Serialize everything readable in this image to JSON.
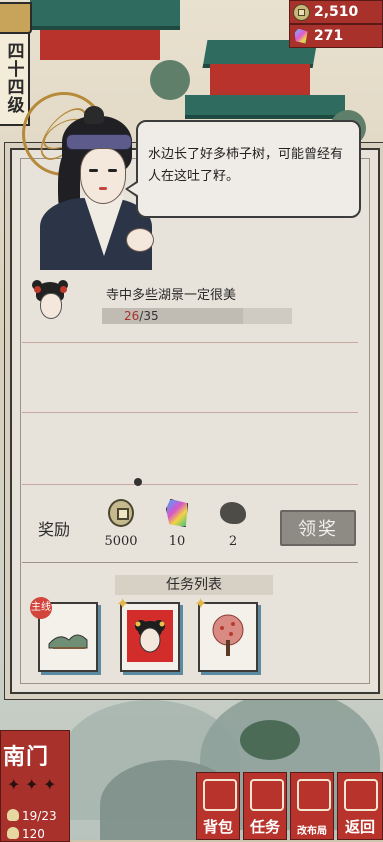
{
  "level": {
    "label": "四十四级"
  },
  "currencies": [
    {
      "icon": "coin-icon",
      "value": "2,510"
    },
    {
      "icon": "gem-icon",
      "value": "271"
    }
  ],
  "dialog": {
    "text": "水边长了好多柿子树，可能曾经有人在这吐了籽。"
  },
  "tasks": [
    {
      "title": "寺中多些湖景一定很美",
      "progress_current": "26",
      "progress_sep_total": "/35",
      "progress_fraction": 0.743
    }
  ],
  "rewards": {
    "label": "奖励",
    "items": [
      {
        "icon": "coin-icon",
        "amount": "5000"
      },
      {
        "icon": "gem-icon",
        "amount": "10"
      },
      {
        "icon": "stone-icon",
        "amount": "2"
      }
    ],
    "claim_label": "领奖"
  },
  "task_list": {
    "title": "任务列表",
    "main_tag": "主线"
  },
  "gate": {
    "name": "南门",
    "residents": "19/23",
    "points": "120"
  },
  "nav": [
    {
      "label": "背包"
    },
    {
      "label": "任务"
    },
    {
      "label": "改布局"
    },
    {
      "label": "返回"
    }
  ],
  "colors": {
    "accent_red": "#a8322b",
    "panel_bg": "#e8e3da",
    "roof_green": "#2f6b5f"
  }
}
